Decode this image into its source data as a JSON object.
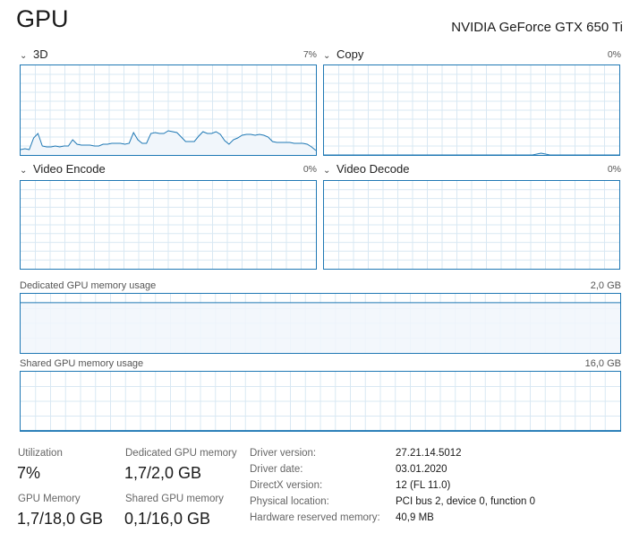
{
  "header": {
    "title": "GPU",
    "gpu_name": "NVIDIA GeForce GTX 650 Ti"
  },
  "engines": [
    {
      "label": "3D",
      "value": "7%",
      "samples": [
        6,
        7,
        6,
        19,
        24,
        10,
        9,
        9,
        10,
        9,
        10,
        10,
        17,
        12,
        11,
        11,
        11,
        10,
        10,
        12,
        12,
        13,
        13,
        13,
        12,
        13,
        25,
        17,
        13,
        13,
        24,
        25,
        24,
        24,
        27,
        26,
        25,
        20,
        15,
        15,
        15,
        21,
        26,
        24,
        24,
        26,
        23,
        16,
        12,
        17,
        19,
        22,
        23,
        23,
        22,
        23,
        22,
        20,
        15,
        14,
        14,
        14,
        14,
        13,
        13,
        13,
        12,
        9,
        5
      ]
    },
    {
      "label": "Copy",
      "value": "0%",
      "samples": [
        0,
        0,
        0,
        0,
        0,
        0,
        0,
        0,
        0,
        0,
        0,
        0,
        0,
        0,
        0,
        0,
        0,
        0,
        0,
        0,
        0,
        0,
        0,
        0,
        0,
        0,
        0,
        0,
        0,
        0,
        0,
        0,
        0,
        0,
        0,
        0,
        0,
        0,
        0,
        0,
        0,
        0,
        0,
        0,
        0,
        0,
        0,
        0,
        0,
        1,
        2,
        1,
        0,
        0,
        0,
        0,
        0,
        0,
        0,
        0,
        0,
        0,
        0,
        0,
        0,
        0,
        0,
        0,
        0
      ]
    },
    {
      "label": "Video Encode",
      "value": "0%",
      "samples": []
    },
    {
      "label": "Video Decode",
      "value": "0%",
      "samples": []
    }
  ],
  "memory_graphs": [
    {
      "label": "Dedicated GPU memory usage",
      "max": "2,0 GB",
      "level": 0.85
    },
    {
      "label": "Shared GPU memory usage",
      "max": "16,0 GB",
      "level": 0.006
    }
  ],
  "stats": [
    {
      "label": "Utilization",
      "value": "7%"
    },
    {
      "label": "Dedicated GPU memory",
      "value": "1,7/2,0 GB"
    },
    {
      "label": "GPU Memory",
      "value": "1,7/18,0 GB"
    },
    {
      "label": "Shared GPU memory",
      "value": "0,1/16,0 GB"
    }
  ],
  "info": [
    {
      "key": "Driver version:",
      "value": "27.21.14.5012"
    },
    {
      "key": "Driver date:",
      "value": "03.01.2020"
    },
    {
      "key": "DirectX version:",
      "value": "12 (FL 11.0)"
    },
    {
      "key": "Physical location:",
      "value": "PCI bus 2, device 0, function 0"
    },
    {
      "key": "Hardware reserved memory:",
      "value": "40,9 MB"
    }
  ],
  "colors": {
    "line": "#1f78b4",
    "grid": "#d9e8f3",
    "fill": "#f1f6fb"
  },
  "icons": {
    "collapse": "chevron-down-icon"
  }
}
